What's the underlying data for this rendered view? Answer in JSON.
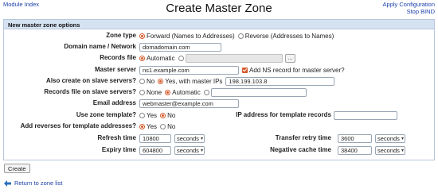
{
  "header": {
    "module_index": "Module Index",
    "title": "Create Master Zone",
    "apply_configuration": "Apply Configuration",
    "stop_bind": "Stop BIND"
  },
  "panel": {
    "heading": "New master zone options"
  },
  "fields": {
    "zone_type": {
      "label": "Zone type",
      "forward": "Forward (Names to Addresses)",
      "reverse": "Reverse (Addresses to Names)",
      "selected": "forward"
    },
    "domain_name": {
      "label": "Domain name / Network",
      "value": "domadomain.com"
    },
    "records_file": {
      "label": "Records file",
      "automatic": "Automatic",
      "value": "",
      "browse_label": "..."
    },
    "master_server": {
      "label": "Master server",
      "value": "ns1.example.com",
      "add_ns_label": "Add NS record for master server?",
      "add_ns_checked": true
    },
    "slave_servers": {
      "label": "Also create on slave servers?",
      "no": "No",
      "yes": "Yes, with master IPs",
      "ips": "198.199.103.8"
    },
    "slave_records": {
      "label": "Records file on slave servers?",
      "none": "None",
      "automatic": "Automatic",
      "value": ""
    },
    "email": {
      "label": "Email address",
      "value": "webmaster@example.com"
    },
    "template": {
      "label": "Use zone template?",
      "yes": "Yes",
      "no": "No",
      "ip_label": "IP address for template records",
      "ip_value": ""
    },
    "reverses": {
      "label": "Add reverses for template addresses?",
      "yes": "Yes",
      "no": "No"
    },
    "refresh": {
      "label": "Refresh time",
      "value": "10800",
      "unit": "seconds"
    },
    "retry": {
      "label": "Transfer retry time",
      "value": "3600",
      "unit": "seconds"
    },
    "expiry": {
      "label": "Expiry time",
      "value": "604800",
      "unit": "seconds"
    },
    "negative": {
      "label": "Negative cache time",
      "value": "38400",
      "unit": "seconds"
    }
  },
  "actions": {
    "create": "Create",
    "return": "Return to zone list"
  },
  "colors": {
    "accent": "#d55a2b",
    "link": "#1a3fa8",
    "panel_header": "#d5e2f2"
  },
  "icons": {
    "return": "left-arrow-icon",
    "dropdown": "chevron-down-icon"
  }
}
